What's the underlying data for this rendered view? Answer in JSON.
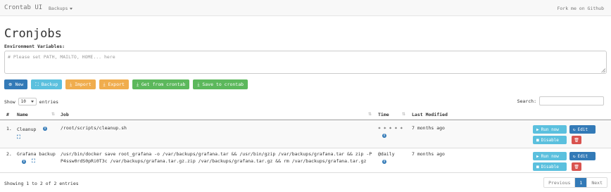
{
  "navbar": {
    "brand": "Crontab UI",
    "backups_menu": "Backups",
    "github_link": "Fork me on Github"
  },
  "page_title": "Cronjobs",
  "env": {
    "label": "Environment Variables:",
    "placeholder": "# Please set PATH, MAILTO, HOME... here"
  },
  "toolbar": {
    "new": "New",
    "backup": "Backup",
    "import": "Import",
    "export": "Export",
    "get": "Get from crontab",
    "save": "Save to crontab"
  },
  "table_controls": {
    "show": "Show",
    "entries_count": "10",
    "entries": "entries",
    "search": "Search:"
  },
  "columns": {
    "num": "#",
    "name": "Name",
    "job": "Job",
    "time": "Time",
    "modified": "Last Modified"
  },
  "rows": [
    {
      "num": "1.",
      "name": "Cleanup",
      "job": "/root/scripts/cleanup.sh",
      "time": "* * * * *",
      "modified": "7 months ago",
      "run": "Run now",
      "edit": "Edit",
      "disable": "Disable"
    },
    {
      "num": "2.",
      "name": "Grafana backup",
      "job_line1": "/usr/bin/docker save root_grafana -o /var/backups/grafana.tar && /usr/bin/gzip /var/backups/grafana.tar && zip -P",
      "job_line2": "P4ssw0rdS0pRi0T3c /var/backups/grafana.tar.gz.zip /var/backups/grafana.tar.gz && rm /var/backups/grafana.tar.gz",
      "time": "@daily",
      "modified": "7 months ago",
      "run": "Run now",
      "edit": "Edit",
      "disable": "Disable"
    }
  ],
  "footer": {
    "info": "Showing 1 to 2 of 2 entries",
    "previous": "Previous",
    "page": "1",
    "next": "Next"
  },
  "icons": {
    "new": "plus-circle-icon",
    "backup": "backup-icon",
    "import": "download-icon",
    "export": "download-icon",
    "run": "play-icon",
    "edit": "edit-icon",
    "disable": "stop-icon",
    "delete": "trash-icon",
    "info": "info-icon"
  },
  "colors": {
    "primary": "#337ab7",
    "info": "#5bc0de",
    "warning": "#f0ad4e",
    "success": "#5cb85c",
    "danger": "#d9534f"
  }
}
